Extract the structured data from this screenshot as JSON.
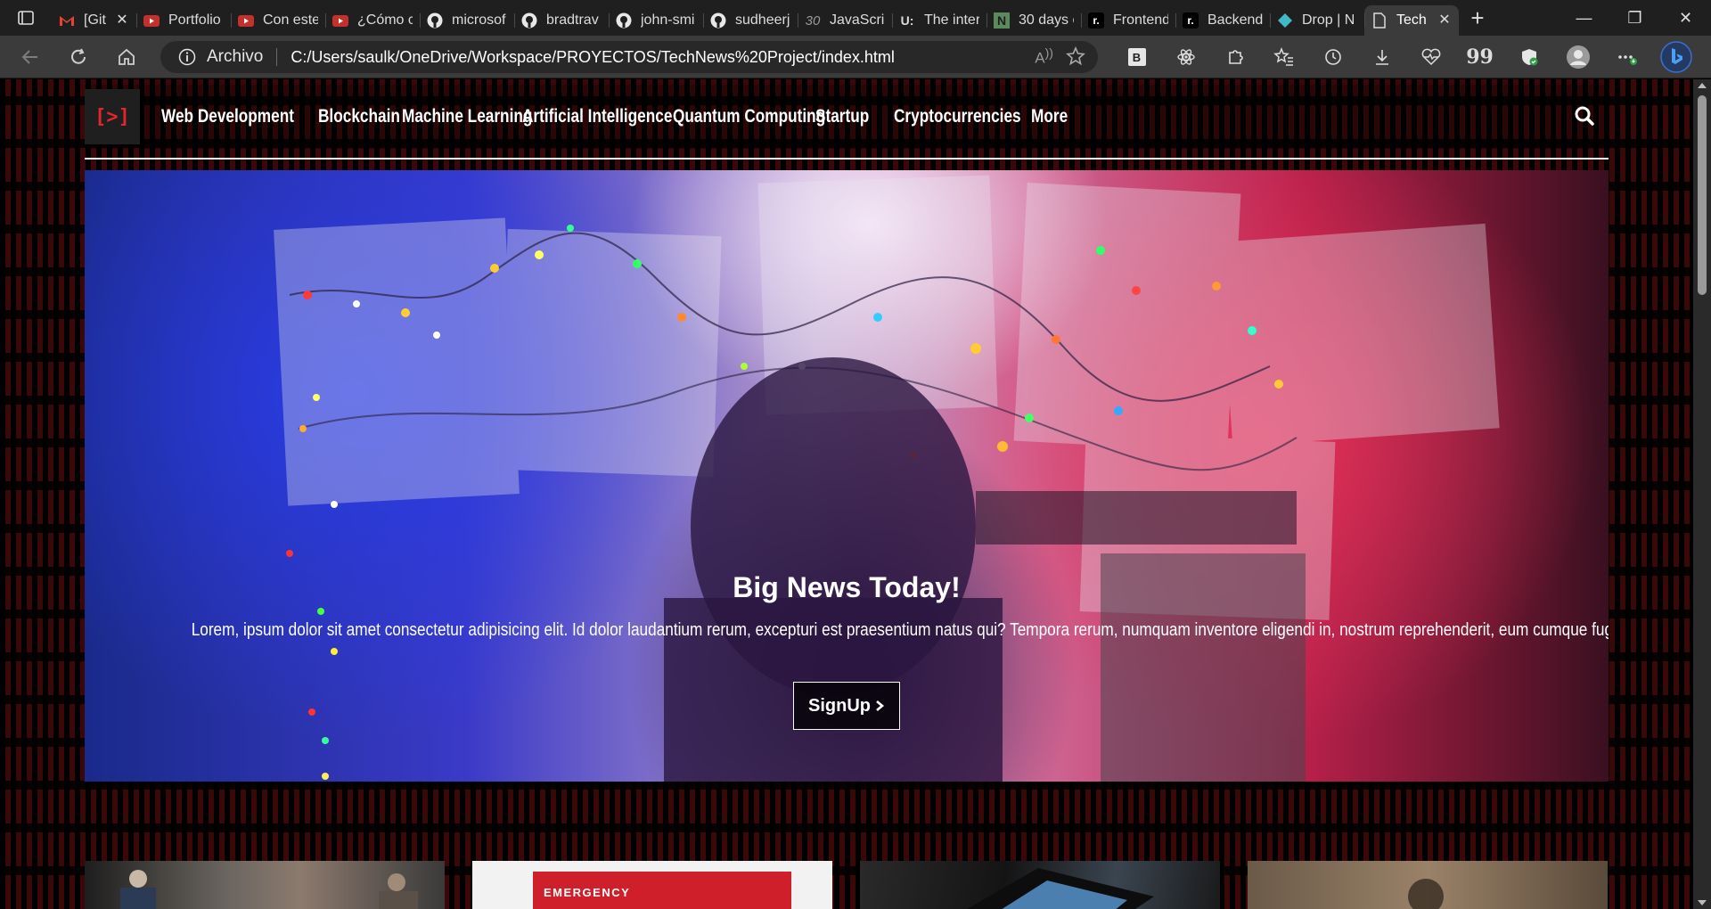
{
  "browser": {
    "tabs": [
      {
        "label": "[Git",
        "icon": "gmail-icon",
        "closable": true
      },
      {
        "label": "Portfolio",
        "icon": "youtube-icon"
      },
      {
        "label": "Con este",
        "icon": "youtube-icon"
      },
      {
        "label": "¿Cómo c",
        "icon": "youtube-icon"
      },
      {
        "label": "microsof",
        "icon": "github-icon"
      },
      {
        "label": "bradtrav",
        "icon": "github-icon"
      },
      {
        "label": "john-smi",
        "icon": "github-icon"
      },
      {
        "label": "sudheerj",
        "icon": "github-icon"
      },
      {
        "label": "JavaScrip",
        "icon": "thirty-icon",
        "icon_text": "30"
      },
      {
        "label": "The inter",
        "icon": "udemy-icon",
        "icon_text": "U:"
      },
      {
        "label": "30 days c",
        "icon": "notion-icon",
        "icon_text": "N"
      },
      {
        "label": "Frontend",
        "icon": "roadmap-icon",
        "icon_text": "r."
      },
      {
        "label": "Backend",
        "icon": "roadmap-icon",
        "icon_text": "r."
      },
      {
        "label": "Drop | N",
        "icon": "drop-icon"
      },
      {
        "label": "Tech",
        "icon": "page-icon",
        "active": true,
        "closable": true
      }
    ],
    "address": {
      "scheme_label": "Archivo",
      "url": "C:/Users/saulk/OneDrive/Workspace/PROYECTOS/TechNews%20Project/index.html"
    },
    "extension_b_label": "B",
    "quote_label": "99"
  },
  "site": {
    "logo_text": "[>]",
    "nav": [
      "Web Development",
      "Blockchain",
      "Machine Learning",
      "Artificial Intelligence",
      "Quantum Computing",
      "Startup",
      "Cryptocurrencies",
      "More"
    ],
    "hero": {
      "title": "Big News Today!",
      "text": "Lorem, ipsum dolor sit amet consectetur adipisicing elit. Id dolor laudantium rerum, excepturi est praesentium natus qui? Tempora rerum, numquam inventore eligendi in, nostrum reprehenderit, eum cumque fugit eaque similique!",
      "button_label": "SignUp"
    },
    "cards": [
      {
        "icon": "photo-people-icon"
      },
      {
        "icon": "photo-emergency-icon",
        "sign_text": "EMERGENCY"
      },
      {
        "icon": "photo-tablet-icon"
      },
      {
        "icon": "photo-texture-icon"
      }
    ]
  }
}
